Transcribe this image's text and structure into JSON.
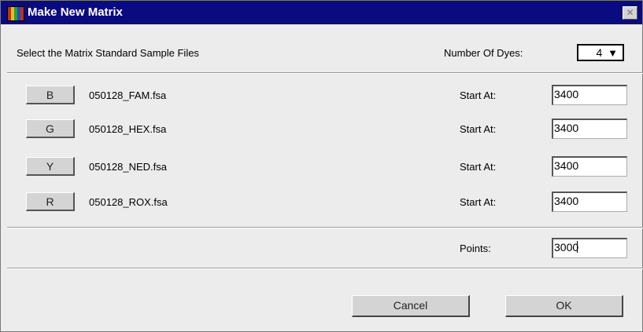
{
  "window": {
    "title": "Make New Matrix",
    "close_symbol": "✕"
  },
  "header": {
    "instruction": "Select the Matrix Standard Sample Files",
    "dyes_label": "Number Of Dyes:",
    "dyes_value": "4",
    "dyes_arrow": "▼"
  },
  "rows": [
    {
      "button": "B",
      "file": "050128_FAM.fsa",
      "start_label": "Start At:",
      "start_value": "3400"
    },
    {
      "button": "G",
      "file": "050128_HEX.fsa",
      "start_label": "Start At:",
      "start_value": "3400"
    },
    {
      "button": "Y",
      "file": "050128_NED.fsa",
      "start_label": "Start At:",
      "start_value": "3400"
    },
    {
      "button": "R",
      "file": "050128_ROX.fsa",
      "start_label": "Start At:",
      "start_value": "3400"
    }
  ],
  "points": {
    "label": "Points:",
    "value": "3000"
  },
  "actions": {
    "cancel": "Cancel",
    "ok": "OK"
  }
}
